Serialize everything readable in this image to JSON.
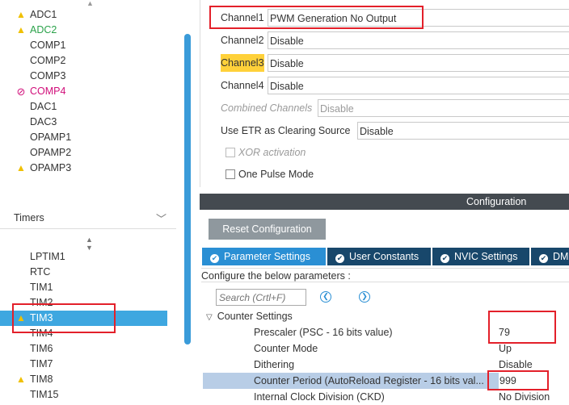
{
  "peripherals": [
    {
      "name": "ADC1",
      "status": "warning",
      "icon": "warning-icon"
    },
    {
      "name": "ADC2",
      "status": "warning-green",
      "icon": "warning-icon"
    },
    {
      "name": "COMP1",
      "status": "none"
    },
    {
      "name": "COMP2",
      "status": "none"
    },
    {
      "name": "COMP3",
      "status": "none"
    },
    {
      "name": "COMP4",
      "status": "blocked",
      "icon": "blocked-icon"
    },
    {
      "name": "DAC1",
      "status": "none"
    },
    {
      "name": "DAC3",
      "status": "none"
    },
    {
      "name": "OPAMP1",
      "status": "none"
    },
    {
      "name": "OPAMP2",
      "status": "none"
    },
    {
      "name": "OPAMP3",
      "status": "warning",
      "icon": "warning-icon"
    }
  ],
  "timers": {
    "title": "Timers",
    "items": [
      {
        "name": "LPTIM1",
        "status": "none"
      },
      {
        "name": "RTC",
        "status": "none"
      },
      {
        "name": "TIM1",
        "status": "none"
      },
      {
        "name": "TIM2",
        "status": "none"
      },
      {
        "name": "TIM3",
        "status": "warning",
        "selected": true,
        "icon": "warning-icon"
      },
      {
        "name": "TIM4",
        "status": "none"
      },
      {
        "name": "TIM6",
        "status": "none"
      },
      {
        "name": "TIM7",
        "status": "none"
      },
      {
        "name": "TIM8",
        "status": "warning",
        "icon": "warning-icon"
      },
      {
        "name": "TIM15",
        "status": "none"
      }
    ]
  },
  "mode": {
    "channel1": {
      "label": "Channel1",
      "value": "PWM Generation No Output"
    },
    "channel2": {
      "label": "Channel2",
      "value": "Disable"
    },
    "channel3": {
      "label": "Channel3",
      "value": "Disable"
    },
    "channel4": {
      "label": "Channel4",
      "value": "Disable"
    },
    "combined": {
      "label": "Combined Channels",
      "value": "Disable"
    },
    "etr": {
      "label": "Use ETR as Clearing Source",
      "value": "Disable"
    },
    "xor": {
      "label": "XOR activation",
      "checked": false
    },
    "one_pulse": {
      "label": "One Pulse Mode",
      "checked": false
    }
  },
  "configuration": {
    "title": "Configuration",
    "reset_label": "Reset Configuration",
    "tabs": [
      {
        "label": "Parameter Settings",
        "active": true
      },
      {
        "label": "User Constants",
        "active": false
      },
      {
        "label": "NVIC Settings",
        "active": false
      },
      {
        "label": "DM",
        "active": false
      }
    ],
    "hint": "Configure the below parameters :",
    "search_placeholder": "Search (Crtl+F)",
    "group": "Counter Settings",
    "params": [
      {
        "name": "Prescaler (PSC - 16 bits value)",
        "value": "79"
      },
      {
        "name": "Counter Mode",
        "value": "Up"
      },
      {
        "name": "Dithering",
        "value": "Disable"
      },
      {
        "name": "Counter Period (AutoReload Register - 16 bits val...",
        "value": "999"
      },
      {
        "name": "Internal Clock Division (CKD)",
        "value": "No Division"
      }
    ]
  },
  "colors": {
    "accent": "#2a8fd4",
    "selected_row": "#3ea7e0",
    "warning": "#f0c000",
    "blocked": "#d10e7a",
    "highlight": "#ffd13a",
    "annotation_red": "#e3202a"
  }
}
